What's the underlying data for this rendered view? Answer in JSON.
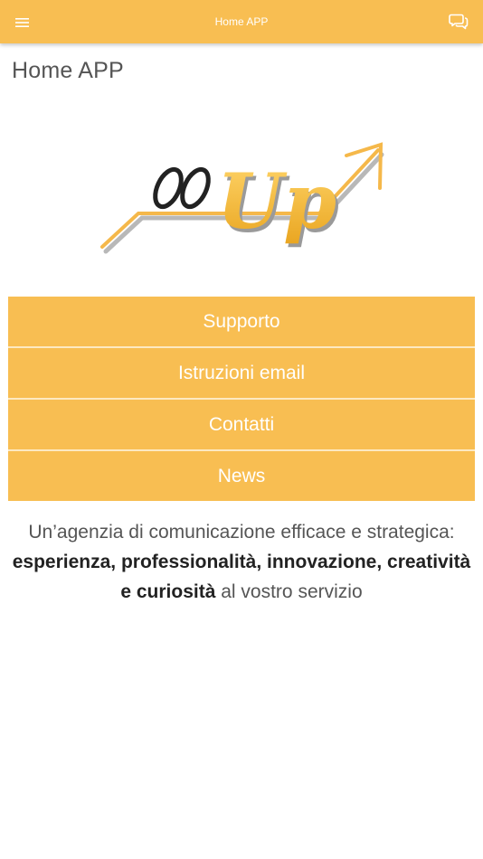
{
  "topbar": {
    "title": "Home APP",
    "menu_icon": "hamburger-menu-icon",
    "chat_icon": "chat-bubbles-icon",
    "color": "#f8be52"
  },
  "page": {
    "title": "Home APP"
  },
  "logo": {
    "text": "ooUp",
    "icon": "arrow-up-logo"
  },
  "menu": {
    "items": [
      {
        "label": "Supporto"
      },
      {
        "label": "Istruzioni email"
      },
      {
        "label": "Contatti"
      },
      {
        "label": "News"
      }
    ]
  },
  "tagline": {
    "intro": "Un’agenzia di comunicazione efficace e strategica:",
    "bold": "esperienza, professionalità, innovazione, creatività e curiosità",
    "outro": " al vostro servizio"
  }
}
